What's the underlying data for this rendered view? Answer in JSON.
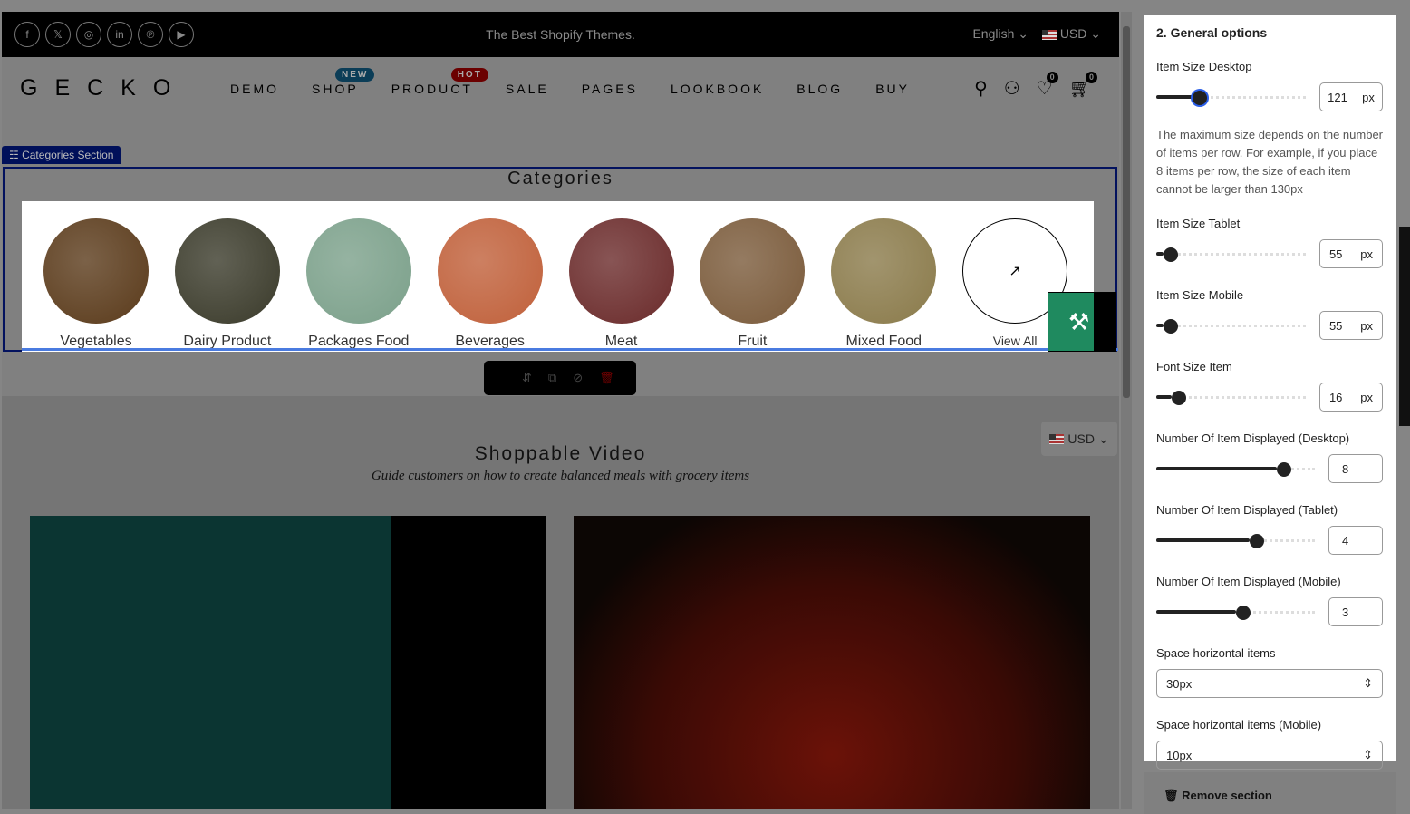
{
  "topbar": {
    "social": [
      "f",
      "𝕏",
      "◎",
      "in",
      "℗",
      "▶"
    ],
    "tagline": "The Best Shopify Themes.",
    "language": "English ⌄",
    "currency": "USD ⌄"
  },
  "nav": {
    "logo": "GECKO",
    "items": [
      {
        "label": "DEMO"
      },
      {
        "label": "SHOP",
        "badge": "NEW",
        "badge_color": "#0b3d57"
      },
      {
        "label": "PRODUCT",
        "badge": "HOT",
        "badge_color": "#6b0000"
      },
      {
        "label": "SALE"
      },
      {
        "label": "PAGES"
      },
      {
        "label": "LOOKBOOK"
      },
      {
        "label": "BLOG"
      },
      {
        "label": "BUY"
      }
    ],
    "wishlist_count": "0",
    "cart_count": "0"
  },
  "section_tag": "☷ Categories Section",
  "categories": {
    "title": "Categories",
    "items": [
      {
        "label": "Vegetables",
        "color": "#5a3a1a"
      },
      {
        "label": "Dairy Product",
        "color": "#3a3a2a"
      },
      {
        "label": "Packages Food",
        "color": "#7ba08a"
      },
      {
        "label": "Beverages",
        "color": "#c0603a"
      },
      {
        "label": "Meat",
        "color": "#6a2a2a"
      },
      {
        "label": "Fruit",
        "color": "#7a5a3a"
      },
      {
        "label": "Mixed Food",
        "color": "#8a7a4a"
      }
    ],
    "view_all": "View All"
  },
  "video": {
    "currency": "USD ⌄",
    "title": "Shoppable Video",
    "subtitle": "Guide customers on how to create balanced meals with grocery items"
  },
  "panel": {
    "heading": "2. General options",
    "item_size_desktop": {
      "label": "Item Size Desktop",
      "value": "121",
      "unit": "px",
      "percent": 24
    },
    "description": "The maximum size depends on the number of items per row. For example, if you place 8 items per row, the size of each item cannot be larger than 130px",
    "item_size_tablet": {
      "label": "Item Size Tablet",
      "value": "55",
      "unit": "px",
      "percent": 5
    },
    "item_size_mobile": {
      "label": "Item Size Mobile",
      "value": "55",
      "unit": "px",
      "percent": 5
    },
    "font_size": {
      "label": "Font Size Item",
      "value": "16",
      "unit": "px",
      "percent": 10
    },
    "items_desktop": {
      "label": "Number Of Item Displayed (Desktop)",
      "value": "8",
      "percent": 76
    },
    "items_tablet": {
      "label": "Number Of Item Displayed (Tablet)",
      "value": "4",
      "percent": 59
    },
    "items_mobile": {
      "label": "Number Of Item Displayed (Mobile)",
      "value": "3",
      "percent": 50
    },
    "space_h": {
      "label": "Space horizontal items",
      "value": "30px"
    },
    "space_h_mobile": {
      "label": "Space horizontal items (Mobile)",
      "value": "10px"
    },
    "remove": "Remove section"
  }
}
